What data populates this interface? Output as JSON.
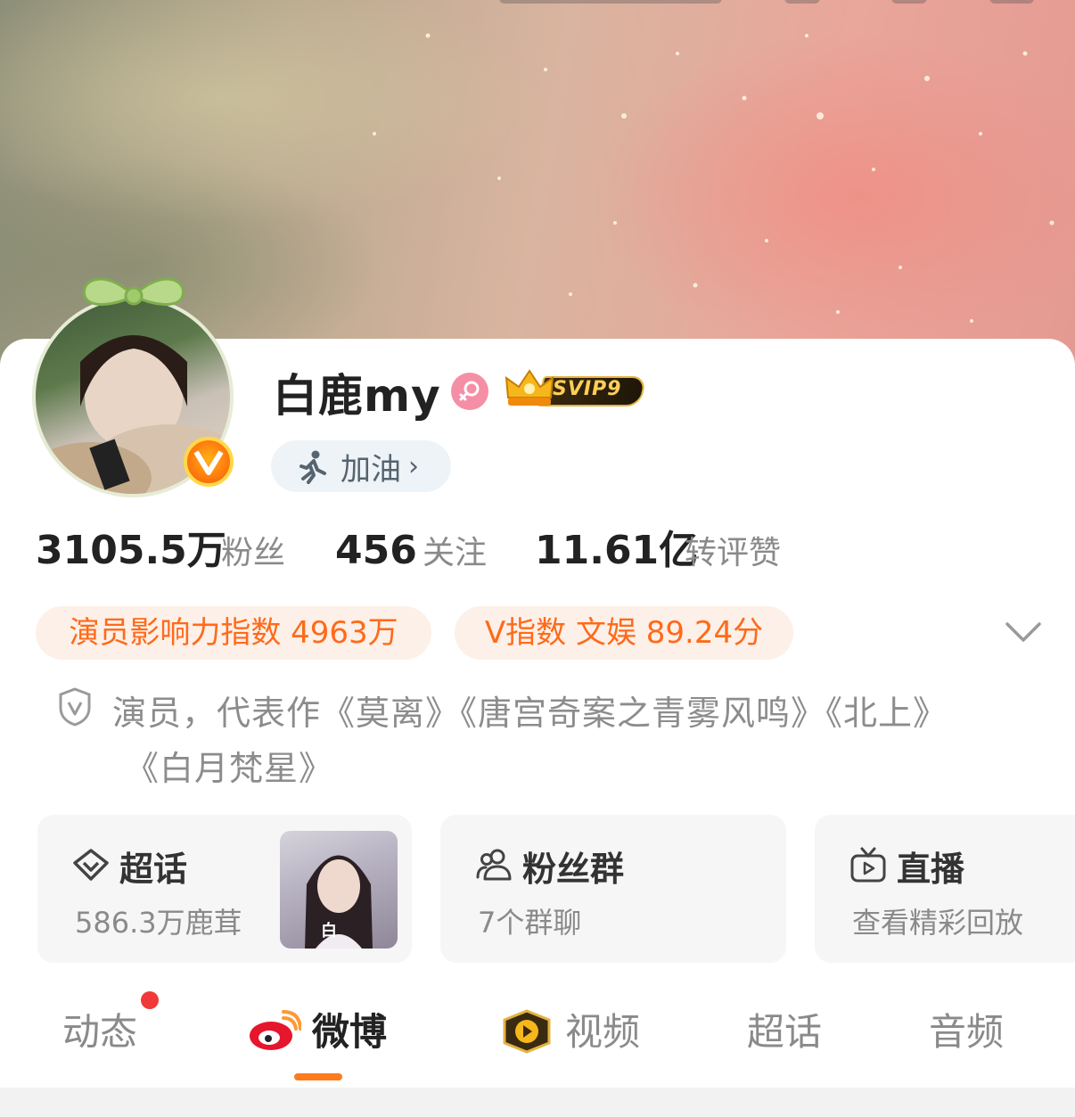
{
  "profile": {
    "name": "白鹿my",
    "vip_badge": "SVIP9",
    "status_label": "加油",
    "status_chevron": "›"
  },
  "stats": {
    "fans_value": "3105.5万",
    "fans_label": "粉丝",
    "following_value": "456",
    "following_label": "关注",
    "interactions_value": "11.61亿",
    "interactions_label": "转评赞"
  },
  "chips": {
    "influence": "演员影响力指数 4963万",
    "v_index": "V指数 文娱 89.24分"
  },
  "description": {
    "line1": "演员，代表作《莫离》《唐宫奇案之青雾风鸣》《北上》",
    "line2": "《白月梵星》"
  },
  "feature_cards": {
    "supertopic": {
      "title": "超话",
      "subtitle": "586.3万鹿茸",
      "thumb_text": "白"
    },
    "fan_group": {
      "title": "粉丝群",
      "subtitle": "7个群聊"
    },
    "live": {
      "title": "直播",
      "subtitle": "查看精彩回放"
    }
  },
  "tabs": [
    {
      "label": "动态",
      "badge": "red-dot"
    },
    {
      "label": "微博",
      "active": true
    },
    {
      "label": "视频"
    },
    {
      "label": "超话"
    },
    {
      "label": "音频"
    }
  ],
  "icons": {
    "gender": "female-icon",
    "avatar_badge": "v-verified-icon",
    "status": "runner-icon",
    "expand": "chevron-down-icon",
    "verify": "shield-v-icon",
    "supertopic": "diamond-icon",
    "fan_group": "people-icon",
    "live": "tv-icon",
    "weibo_tab": "weibo-logo-icon",
    "video_tab": "video-play-icon"
  },
  "colors": {
    "accent": "#ff6a1a",
    "chip_bg": "#fdf0e8",
    "gender_pink": "#f58fa6",
    "tab_underline": "#ff7a1a",
    "notification_dot": "#f03a3a"
  }
}
